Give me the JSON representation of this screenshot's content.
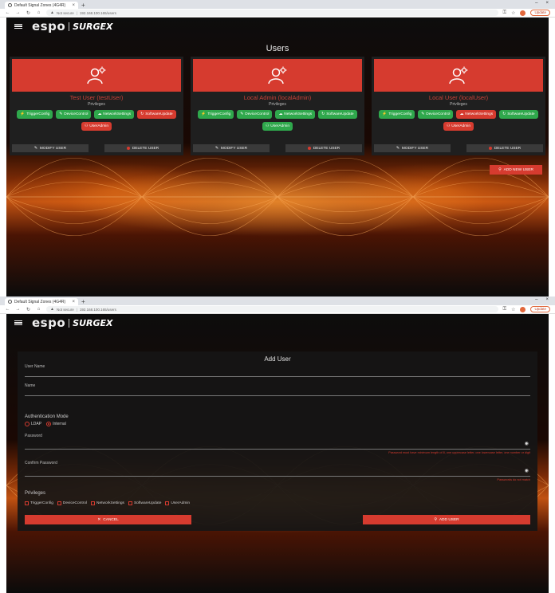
{
  "browser": {
    "tab_title": "Default Signal Zones (4G4R)",
    "tab_close": "×",
    "new_tab": "+",
    "minimize": "–",
    "close": "×",
    "not_secure": "Not secure",
    "url": "192.168.100.165/users",
    "update_label": "Update"
  },
  "app": {
    "brand_espo": "espo",
    "brand_surge": "SURGEX"
  },
  "users_page": {
    "title": "Users",
    "privileges_label": "Privileges",
    "modify_label": "MODIFY USER",
    "delete_label": "DELETE USER",
    "add_new_label": "ADD NEW USER",
    "users": [
      {
        "name": "Test User (testUser)",
        "privileges": [
          {
            "label": "TriggerConfig",
            "enabled": true
          },
          {
            "label": "DeviceControl",
            "enabled": true
          },
          {
            "label": "NetworkSettings",
            "enabled": true
          },
          {
            "label": "SoftwareUpdate",
            "enabled": false
          },
          {
            "label": "UserAdmin",
            "enabled": false
          }
        ]
      },
      {
        "name": "Local Admin (localAdmin)",
        "privileges": [
          {
            "label": "TriggerConfig",
            "enabled": true
          },
          {
            "label": "DeviceControl",
            "enabled": true
          },
          {
            "label": "NetworkSettings",
            "enabled": true
          },
          {
            "label": "SoftwareUpdate",
            "enabled": true
          },
          {
            "label": "UserAdmin",
            "enabled": true
          }
        ]
      },
      {
        "name": "Local User (localUser)",
        "privileges": [
          {
            "label": "TriggerConfig",
            "enabled": true
          },
          {
            "label": "DeviceControl",
            "enabled": true
          },
          {
            "label": "NetworkSettings",
            "enabled": false
          },
          {
            "label": "SoftwareUpdate",
            "enabled": true
          },
          {
            "label": "UserAdmin",
            "enabled": false
          }
        ]
      }
    ]
  },
  "add_user_page": {
    "title": "Add User",
    "user_name_label": "User Name",
    "name_label": "Name",
    "auth_mode_label": "Authentication Mode",
    "auth_options": [
      {
        "label": "LDAP",
        "selected": false
      },
      {
        "label": "Internal",
        "selected": true
      }
    ],
    "password_label": "Password",
    "password_error": "Password must have minimum length of 8, one uppercase letter, one lowercase letter, one number or digit",
    "confirm_label": "Confirm Password",
    "confirm_error": "Passwords do not match",
    "privileges_label": "Privileges",
    "privileges": [
      "TriggerConfig",
      "DeviceControl",
      "NetworkSettings",
      "SoftwareUpdate",
      "UserAdmin"
    ],
    "cancel_label": "CANCEL",
    "add_label": "ADD USER"
  },
  "colors": {
    "accent_red": "#d63b2f",
    "enabled_green": "#2fa84c",
    "card_bg": "#1f1f1f"
  }
}
